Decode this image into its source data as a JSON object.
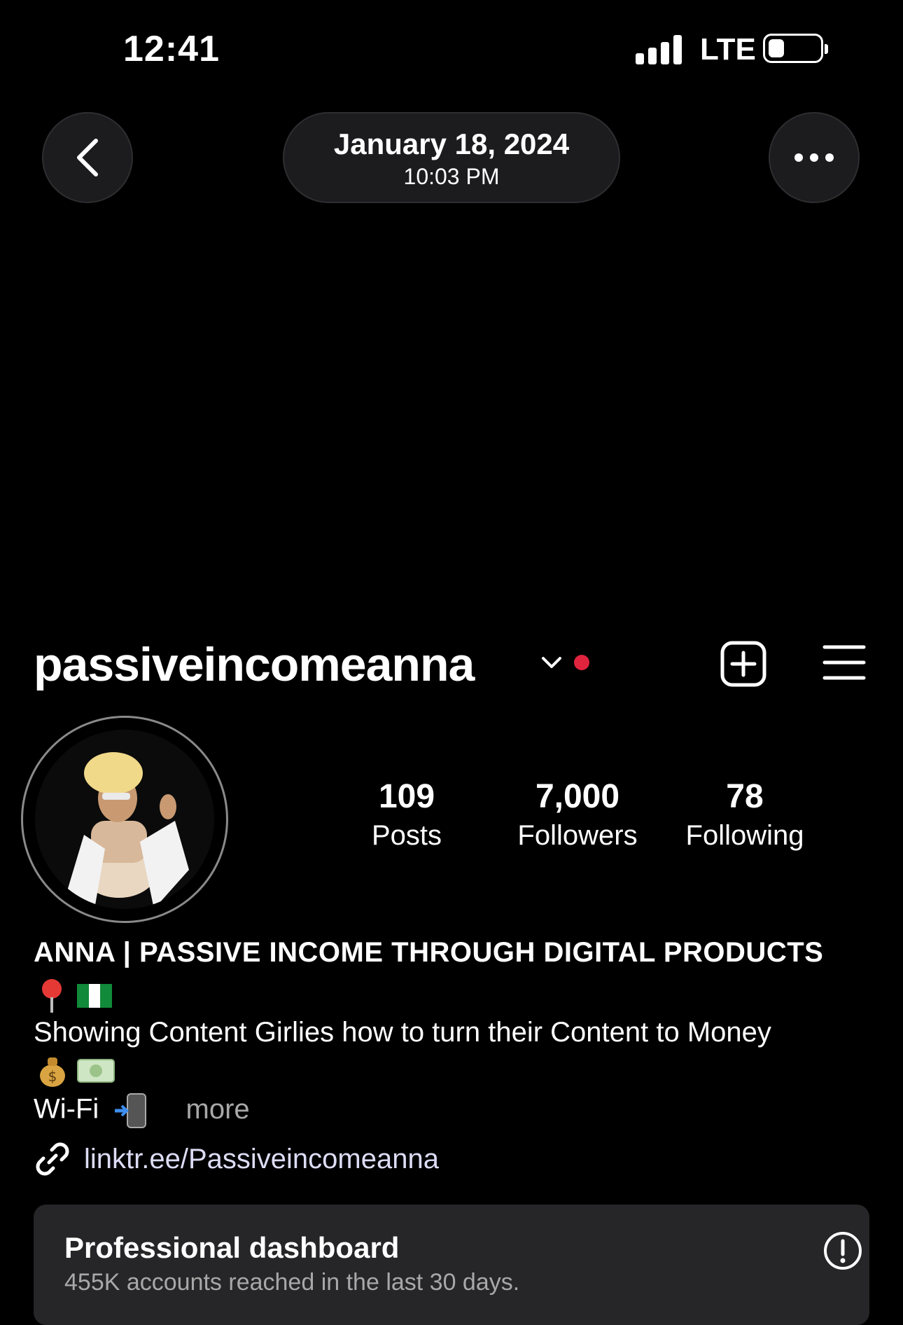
{
  "status_bar": {
    "time": "12:41",
    "network": "LTE"
  },
  "header": {
    "date": "January 18, 2024",
    "time": "10:03 PM"
  },
  "profile": {
    "username": "passiveincomeanna",
    "stats": [
      {
        "value": "109",
        "label": "Posts"
      },
      {
        "value": "7,000",
        "label": "Followers"
      },
      {
        "value": "78",
        "label": "Following"
      }
    ],
    "bio": {
      "name": "ANNA | PASSIVE INCOME THROUGH DIGITAL PRODUCTS",
      "line2": "Showing Content Girlies how to turn their Content to Money",
      "line4": "Wi-Fi",
      "more": "more"
    },
    "link": "linktr.ee/Passiveincomeanna"
  },
  "dashboard": {
    "title": "Professional dashboard",
    "subtitle": "455K accounts reached in the last 30 days."
  },
  "icons": [
    "back-icon",
    "more-icon",
    "chevron-down-icon",
    "add-post-icon",
    "menu-icon",
    "pin-icon",
    "nigeria-flag-icon",
    "money-bag-icon",
    "cash-icon",
    "phone-arrow-icon",
    "link-icon",
    "info-icon"
  ],
  "colors": {
    "background": "#000000",
    "notification": "#e0243e",
    "card": "#262628"
  }
}
